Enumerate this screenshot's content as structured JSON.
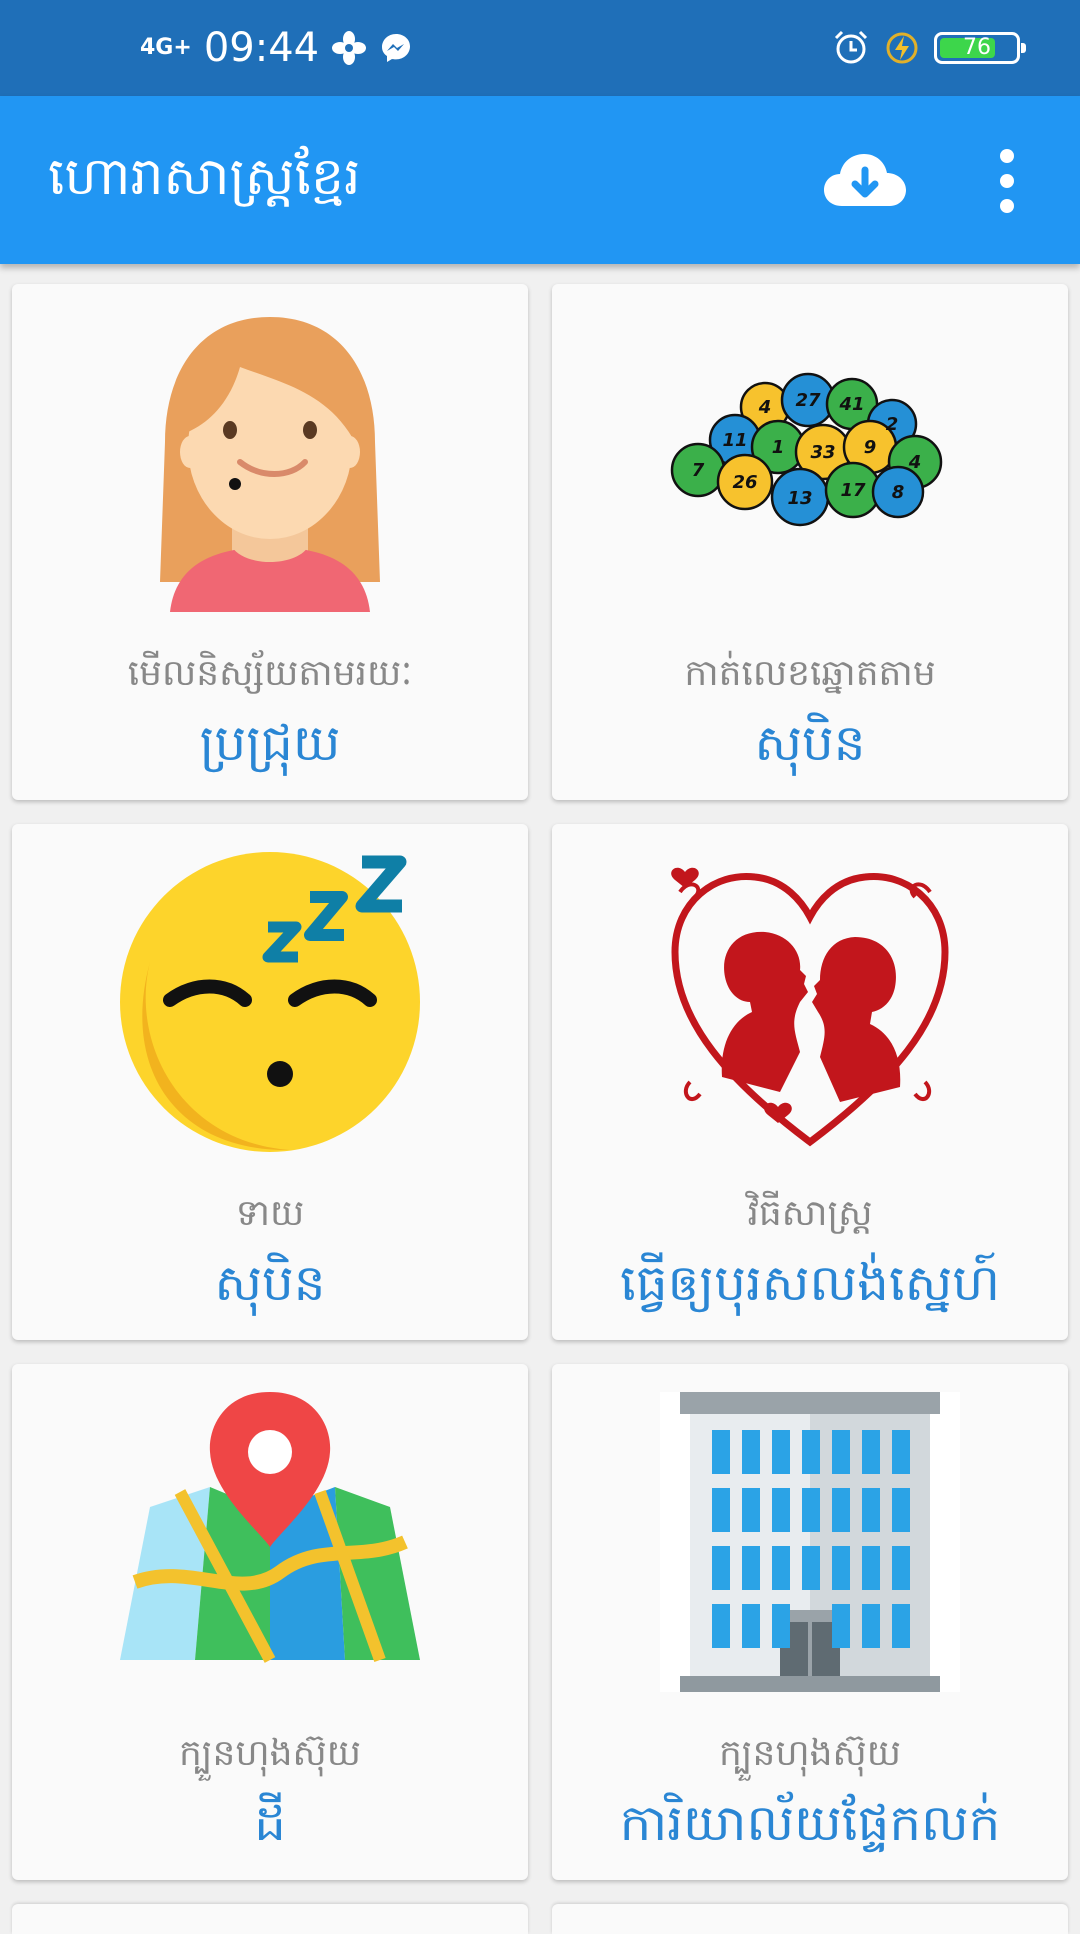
{
  "status_bar": {
    "network": "4G+",
    "time": "09:44",
    "battery_level": "76",
    "battery_fraction": 0.76
  },
  "app_bar": {
    "title": "ហោរាសាស្ត្រខ្មែរ",
    "icons": [
      "cloud-download-icon",
      "more-vert-icon"
    ]
  },
  "cards": [
    {
      "subtitle": "មើលនិស្ស័យតាមរយៈ",
      "title": "ប្រជ្រុយ",
      "icon": "girl-face-icon"
    },
    {
      "subtitle": "កាត់លេខឆ្នោតតាម",
      "title": "សុបិន",
      "icon": "lottery-balls-icon"
    },
    {
      "subtitle": "ទាយ",
      "title": "សុបិន",
      "icon": "sleeping-emoji-icon"
    },
    {
      "subtitle": "វិធីសាស្ត្រ",
      "title": "ធ្វើឲ្យបុរសលង់ស្នេហ៍",
      "icon": "kissing-couple-heart-icon"
    },
    {
      "subtitle": "ក្បួនហុងស៊ុយ",
      "title": "ដី",
      "icon": "map-pin-icon"
    },
    {
      "subtitle": "ក្បួនហុងស៊ុយ",
      "title": "ការិយាល័យផ្ទែកលក់",
      "icon": "office-building-icon"
    }
  ],
  "lottery_numbers": [
    "4",
    "27",
    "41",
    "2",
    "11",
    "1",
    "33",
    "9",
    "7",
    "26",
    "13",
    "17",
    "8",
    "4"
  ]
}
